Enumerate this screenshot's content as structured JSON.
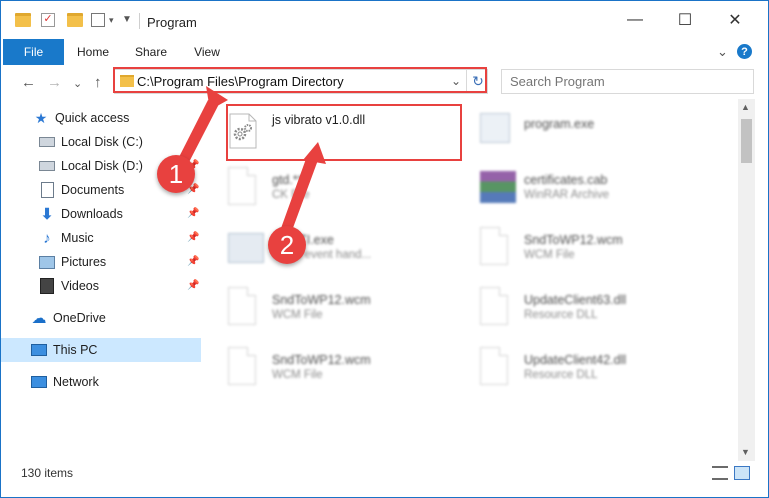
{
  "window": {
    "title": "Program",
    "minimize_glyph": "—",
    "maximize_glyph": "☐",
    "close_glyph": "✕"
  },
  "ribbon": {
    "tabs": [
      "File",
      "Home",
      "Share",
      "View"
    ],
    "expand_glyph": "⌄",
    "help_glyph": "?"
  },
  "navigation": {
    "back": "←",
    "forward": "→",
    "recent": "⌄",
    "up": "↑"
  },
  "address": {
    "path": "C:\\Program Files\\Program Directory",
    "dropdown": "⌄",
    "refresh": "↻"
  },
  "search": {
    "placeholder": "Search Program"
  },
  "nav_pane": {
    "items": [
      {
        "label": "Quick access",
        "icon": "star-icon"
      },
      {
        "label": "Local Disk (C:)",
        "icon": "drive-icon",
        "pinned": true
      },
      {
        "label": "Local Disk (D:)",
        "icon": "drive-icon",
        "pinned": true
      },
      {
        "label": "Documents",
        "icon": "document-icon",
        "pinned": true
      },
      {
        "label": "Downloads",
        "icon": "download-icon",
        "pinned": true
      },
      {
        "label": "Music",
        "icon": "music-icon",
        "pinned": true
      },
      {
        "label": "Pictures",
        "icon": "pictures-icon",
        "pinned": true
      },
      {
        "label": "Videos",
        "icon": "videos-icon",
        "pinned": true
      },
      {
        "label": "OneDrive",
        "icon": "cloud-icon"
      },
      {
        "label": "This PC",
        "icon": "computer-icon",
        "selected": true
      },
      {
        "label": "Network",
        "icon": "network-icon"
      }
    ]
  },
  "files": {
    "highlighted": {
      "name": "js vibrato v1.0.dll",
      "icon": "dll-gear-icon"
    },
    "left_column": [
      {
        "name": "gtd.***",
        "desc": "CK File"
      },
      {
        "name": "yyySTI.exe",
        "desc": "V1 sb event hand..."
      },
      {
        "name": "SndToWP12.wcm",
        "desc": "WCM File"
      },
      {
        "name": "SndToWP12.wcm",
        "desc": "WCM File"
      }
    ],
    "right_column": [
      {
        "name": "program.exe",
        "desc": ""
      },
      {
        "name": "certificates.cab",
        "desc": "WinRAR Archive"
      },
      {
        "name": "SndToWP12.wcm",
        "desc": "WCM File"
      },
      {
        "name": "UpdateClient63.dll",
        "desc": "Resource DLL"
      },
      {
        "name": "UpdateClient42.dll",
        "desc": "Resource DLL"
      }
    ]
  },
  "status": {
    "item_count": "130 items"
  },
  "annotations": {
    "step1": "1",
    "step2": "2"
  },
  "colors": {
    "accent": "#1979ca",
    "callout": "#e8413f",
    "selection": "#cce8ff"
  }
}
